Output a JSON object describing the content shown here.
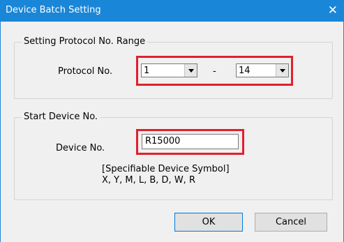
{
  "window": {
    "title": "Device Batch Setting",
    "close_glyph": "✕"
  },
  "protocol_group": {
    "legend": "Setting Protocol No. Range",
    "label": "Protocol No.",
    "from_value": "1",
    "separator": "-",
    "to_value": "14"
  },
  "device_group": {
    "legend": "Start Device No.",
    "label": "Device No.",
    "value": "R15000",
    "hint_line1": "[Specifiable Device Symbol]",
    "hint_line2": "X, Y, M, L, B, D, W, R"
  },
  "buttons": {
    "ok": "OK",
    "cancel": "Cancel"
  },
  "colors": {
    "titlebar": "#1a86d8",
    "highlight": "#e0202d"
  }
}
